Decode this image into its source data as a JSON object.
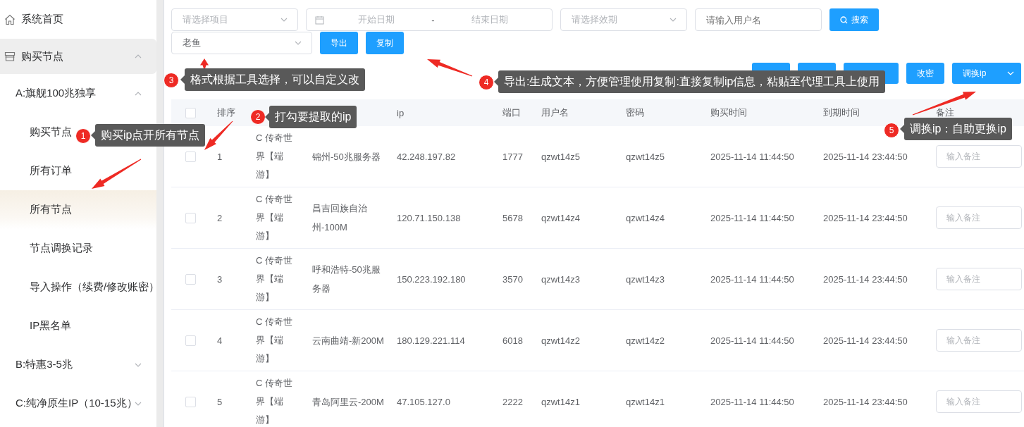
{
  "sidebar": {
    "items": [
      {
        "label": "系统首页",
        "selected": false
      },
      {
        "label": "购买节点",
        "expanded": true,
        "children": [
          {
            "label": "A:旗舰100兆独享",
            "expanded": true,
            "children": [
              {
                "label": "购买节点",
                "selected": false
              },
              {
                "label": "所有订单",
                "selected": false
              },
              {
                "label": "所有节点",
                "selected": true
              },
              {
                "label": "节点调换记录",
                "selected": false
              },
              {
                "label": "导入操作（续费/修改账密）",
                "selected": false
              },
              {
                "label": "IP黑名单",
                "selected": false
              }
            ]
          },
          {
            "label": "B:特惠3-5兆",
            "expanded": false
          },
          {
            "label": "C:纯净原生IP（10-15兆）",
            "expanded": false
          }
        ]
      }
    ]
  },
  "filters": {
    "project": {
      "placeholder": "请选择项目"
    },
    "start_date": {
      "placeholder": "开始日期"
    },
    "separator": "-",
    "end_date": {
      "placeholder": "结束日期"
    },
    "validity": {
      "placeholder": "请选择效期"
    },
    "username": {
      "placeholder": "请输入用户名"
    },
    "search_button": "搜索",
    "format": {
      "value": "老鱼"
    },
    "export_button": "导出",
    "copy_button": "复制"
  },
  "actions": [
    {
      "kind": "button"
    },
    {
      "kind": "button"
    },
    {
      "kind": "button"
    },
    {
      "kind": "button",
      "label": "改密"
    },
    {
      "kind": "split",
      "label": "调换ip"
    }
  ],
  "table": {
    "select_all": {
      "checked": false
    },
    "columns": [
      "排序",
      "",
      "",
      "ip",
      "端口",
      "用户名",
      "密码",
      "购买时间",
      "到期时间",
      "备注"
    ],
    "rows": [
      {
        "checked": false,
        "cells": [
          "1",
          "C 传奇世界【端游】",
          "锦州-50兆服务器",
          "42.248.197.82",
          "1777",
          "qzwt14z5",
          "qzwt14z5",
          "2025-11-14 11:44:50",
          "2025-11-14 23:44:50"
        ],
        "note_placeholder": "输入备注"
      },
      {
        "checked": false,
        "cells": [
          "2",
          "C 传奇世界【端游】",
          "昌吉回族自治州-100M",
          "120.71.150.138",
          "5678",
          "qzwt14z4",
          "qzwt14z4",
          "2025-11-14 11:44:50",
          "2025-11-14 23:44:50"
        ],
        "note_placeholder": "输入备注"
      },
      {
        "checked": false,
        "cells": [
          "3",
          "C 传奇世界【端游】",
          "呼和浩特-50兆服务器",
          "150.223.192.180",
          "3570",
          "qzwt14z3",
          "qzwt14z3",
          "2025-11-14 11:44:50",
          "2025-11-14 23:44:50"
        ],
        "note_placeholder": "输入备注"
      },
      {
        "checked": false,
        "cells": [
          "4",
          "C 传奇世界【端游】",
          "云南曲靖-新200M",
          "180.129.221.114",
          "6018",
          "qzwt14z2",
          "qzwt14z2",
          "2025-11-14 11:44:50",
          "2025-11-14 23:44:50"
        ],
        "note_placeholder": "输入备注"
      },
      {
        "checked": false,
        "cells": [
          "5",
          "C 传奇世界【端游】",
          "青岛阿里云-200M",
          "47.105.127.0",
          "2222",
          "qzwt14z1",
          "qzwt14z1",
          "2025-11-14 11:44:50",
          "2025-11-14 23:44:50"
        ],
        "note_placeholder": "输入备注"
      }
    ]
  },
  "annotations": [
    {
      "number": "3",
      "text": "格式根据工具选择，可以自定义改"
    },
    {
      "number": "4",
      "text": "导出:生成文本，方便管理使用复制:直接复制ip信息，粘贴至代理工具上使用"
    },
    {
      "number": "2",
      "text": "打勾要提取的ip"
    },
    {
      "number": "5",
      "text": "调换ip：自助更换ip"
    },
    {
      "number": "1",
      "text": "购买ip点开所有节点"
    }
  ]
}
